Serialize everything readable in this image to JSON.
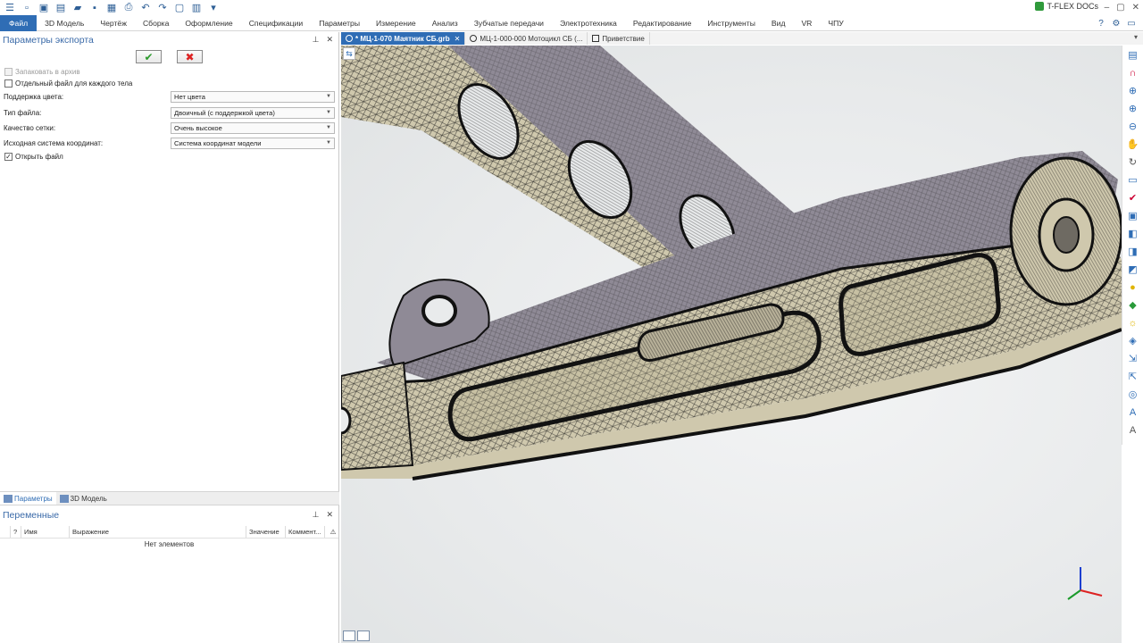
{
  "app": {
    "product": "T-FLEX DOCs"
  },
  "menubar": {
    "items": [
      "Файл",
      "3D Модель",
      "Чертёж",
      "Сборка",
      "Оформление",
      "Спецификации",
      "Параметры",
      "Измерение",
      "Анализ",
      "Зубчатые передачи",
      "Электротехника",
      "Редактирование",
      "Инструменты",
      "Вид",
      "VR",
      "ЧПУ"
    ]
  },
  "export_panel": {
    "title": "Параметры экспорта",
    "pack_archive": {
      "label": "Запаковать в архив",
      "checked": false,
      "disabled": true
    },
    "separate_file": {
      "label": "Отдельный файл для каждого тела",
      "checked": false
    },
    "color_support": {
      "label": "Поддержка цвета:",
      "value": "Нет цвета"
    },
    "file_type": {
      "label": "Тип файла:",
      "value": "Двоичный (с поддержкой цвета)"
    },
    "mesh_quality": {
      "label": "Качество сетки:",
      "value": "Очень высокое"
    },
    "source_cs": {
      "label": "Исходная система координат:",
      "value": "Система координат модели"
    },
    "open_file": {
      "label": "Открыть файл",
      "checked": true
    }
  },
  "bottom_tabs": [
    "Параметры",
    "3D Модель"
  ],
  "variables_panel": {
    "title": "Переменные",
    "columns": [
      "?",
      "Имя",
      "Выражение",
      "Значение",
      "Коммент..."
    ],
    "empty_text": "Нет элементов"
  },
  "doc_tabs": [
    {
      "label": "* МЦ-1-070 Маятник СБ.grb",
      "active": true
    },
    {
      "label": "МЦ-1-000-000 Мотоцикл СБ (...",
      "active": false
    },
    {
      "label": "Приветствие",
      "active": false
    }
  ],
  "colors": {
    "accent": "#2f6db5",
    "model_fill": "#cfc8ad",
    "model_top": "#8f8a96",
    "mesh": "#1c1c1c"
  },
  "icons": {
    "right_toolbar": [
      "table-icon",
      "magnet-icon",
      "zoom-fit-icon",
      "zoom-in-icon",
      "zoom-out-icon",
      "pan-icon",
      "rotate-icon",
      "section-icon",
      "tick-icon",
      "view-cube-icon",
      "view-front-icon",
      "view-top-icon",
      "view-iso-icon",
      "color-sphere-icon",
      "shade-icon",
      "light-icon",
      "render-icon",
      "measure-icon",
      "dimension-icon",
      "camera-icon",
      "text-a-icon",
      "text-a2-icon"
    ]
  }
}
